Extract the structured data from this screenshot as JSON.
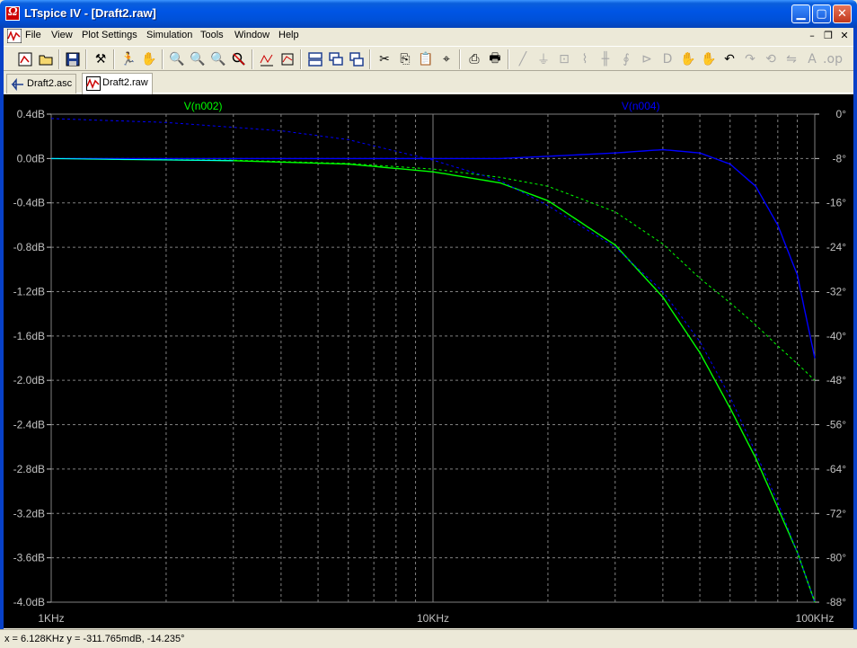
{
  "window": {
    "title": "LTspice IV - [Draft2.raw]",
    "minimize": "▁",
    "maximize": "▢",
    "close": "✕"
  },
  "menu": {
    "items": [
      {
        "label": "File",
        "key": "F"
      },
      {
        "label": "View",
        "key": "V"
      },
      {
        "label": "Plot Settings",
        "key": "P"
      },
      {
        "label": "Simulation",
        "key": "S"
      },
      {
        "label": "Tools",
        "key": "T"
      },
      {
        "label": "Window",
        "key": "W"
      },
      {
        "label": "Help",
        "key": "H"
      }
    ],
    "mdi_minimize": "–",
    "mdi_restore": "❐",
    "mdi_close": "✕"
  },
  "toolbar": {
    "icons": [
      "new-schematic-icon",
      "open-icon",
      "save-icon",
      "control-panel-icon",
      "run-icon",
      "halt-icon",
      "zoom-in-icon",
      "zoom-out-icon",
      "zoom-full-icon",
      "cancel-zoom-icon",
      "autorange-icon",
      "plot-settings-icon",
      "tile-horizontal-icon",
      "cascade-icon",
      "tile-vertical-icon",
      "cut-icon",
      "copy-icon",
      "paste-icon",
      "find-icon",
      "print-preview-icon",
      "print-icon",
      "wire-icon",
      "ground-icon",
      "label-icon",
      "resistor-icon",
      "capacitor-icon",
      "inductor-icon",
      "diode-icon",
      "component-icon",
      "move-icon",
      "drag-icon",
      "undo-icon",
      "redo-icon",
      "rotate-icon",
      "mirror-icon",
      "text-icon",
      "spice-directive-icon"
    ]
  },
  "tabs": [
    {
      "label": "Draft2.asc",
      "icon": "schematic-icon",
      "active": false
    },
    {
      "label": "Draft2.raw",
      "icon": "waveform-icon",
      "active": true
    }
  ],
  "plot": {
    "trace_labels": [
      {
        "name": "V(n002)",
        "color": "#00ff00"
      },
      {
        "name": "V(n004)",
        "color": "#0000ff"
      }
    ],
    "left_axis_labels": [
      "0.4dB",
      "0.0dB",
      "-0.4dB",
      "-0.8dB",
      "-1.2dB",
      "-1.6dB",
      "-2.0dB",
      "-2.4dB",
      "-2.8dB",
      "-3.2dB",
      "-3.6dB",
      "-4.0dB"
    ],
    "right_axis_labels": [
      "0°",
      "-8°",
      "-16°",
      "-24°",
      "-32°",
      "-40°",
      "-48°",
      "-56°",
      "-64°",
      "-72°",
      "-80°",
      "-88°"
    ],
    "x_axis_labels": [
      "1KHz",
      "10KHz",
      "100KHz"
    ],
    "colors": {
      "background": "#000000",
      "grid": "#808080",
      "axis_text": "#c0c0c0",
      "green": "#00ff00",
      "blue": "#0000ff",
      "cursor_cyan": "#00ffff"
    }
  },
  "chart_data": {
    "type": "line",
    "xlabel": "",
    "ylabel": "",
    "x_scale": "log",
    "xlim": [
      1000,
      100000
    ],
    "ylim": [
      -4.0,
      0.4
    ],
    "y2lim": [
      -88,
      0
    ],
    "grid": true,
    "legend": "top",
    "series": [
      {
        "name": "V(n002)",
        "kind": "magnitude",
        "axis": "left",
        "color": "#00ff00",
        "x": [
          1000,
          3000,
          6000,
          10000,
          15000,
          20000,
          30000,
          40000,
          50000,
          60000,
          70000,
          80000,
          90000,
          100000
        ],
        "y": [
          0.0,
          -0.02,
          -0.05,
          -0.12,
          -0.22,
          -0.38,
          -0.78,
          -1.25,
          -1.75,
          -2.25,
          -2.7,
          -3.15,
          -3.55,
          -4.0
        ]
      },
      {
        "name": "V(n002)",
        "kind": "phase",
        "axis": "right",
        "color": "#00ff00",
        "x": [
          1000,
          3000,
          6000,
          10000,
          15000,
          20000,
          30000,
          40000,
          50000,
          60000,
          70000,
          80000,
          90000,
          100000
        ],
        "y": [
          -8.0,
          -8.3,
          -8.9,
          -9.9,
          -11.4,
          -13.0,
          -17.6,
          -23.4,
          -29.6,
          -34.0,
          -38.0,
          -41.8,
          -45.0,
          -48.0
        ]
      },
      {
        "name": "V(n004)",
        "kind": "magnitude",
        "axis": "left",
        "color": "#0000ff",
        "x": [
          1000,
          3000,
          6000,
          10000,
          15000,
          20000,
          30000,
          40000,
          50000,
          60000,
          70000,
          80000,
          90000,
          100000
        ],
        "y": [
          0.0,
          0.0,
          0.0,
          0.0,
          0.0,
          0.02,
          0.05,
          0.08,
          0.05,
          -0.05,
          -0.25,
          -0.6,
          -1.05,
          -1.8
        ]
      },
      {
        "name": "V(n004)",
        "kind": "phase",
        "axis": "right",
        "color": "#0000ff",
        "x": [
          1000,
          2000,
          4000,
          6000,
          10000,
          15000,
          20000,
          30000,
          40000,
          50000,
          60000,
          70000,
          80000,
          90000,
          100000
        ],
        "y": [
          -0.8,
          -1.5,
          -3.0,
          -4.6,
          -8.3,
          -12.0,
          -16.5,
          -24.0,
          -32.0,
          -41.0,
          -51.0,
          -61.0,
          -70.0,
          -79.0,
          -88.0
        ]
      }
    ]
  },
  "status": {
    "cursor_readout": "x = 6.128KHz   y = -311.765mdB, -14.235°"
  }
}
